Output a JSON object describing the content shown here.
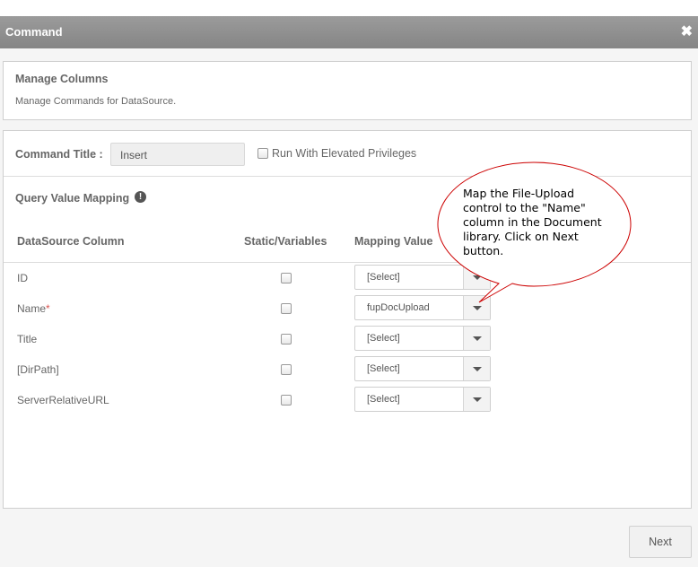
{
  "dialog": {
    "title": "Command",
    "close_glyph": "✖"
  },
  "manage": {
    "heading": "Manage Columns",
    "description": "Manage Commands for DataSource."
  },
  "command_title": {
    "label": "Command Title :",
    "value": "Insert"
  },
  "elevated": {
    "label": "Run With Elevated Privileges",
    "checked": false
  },
  "query_mapping": {
    "heading": "Query Value Mapping",
    "info_icon": "!"
  },
  "table": {
    "headers": [
      "DataSource Column",
      "Static/Variables",
      "Mapping Value"
    ],
    "rows": [
      {
        "column": "ID",
        "required": "",
        "mapping": "[Select]"
      },
      {
        "column": "Name",
        "required": "*",
        "mapping": "fupDocUpload"
      },
      {
        "column": "Title",
        "required": "",
        "mapping": "[Select]"
      },
      {
        "column": "[DirPath]",
        "required": "",
        "mapping": "[Select]"
      },
      {
        "column": "ServerRelativeURL",
        "required": "",
        "mapping": "[Select]"
      }
    ]
  },
  "callout": {
    "text": "Map the File-Upload control to the \"Name\" column in the Document library. Click on Next button."
  },
  "footer": {
    "next_label": "Next"
  },
  "colors": {
    "titlebar": "#8f8f8f",
    "callout_border": "#cc0000",
    "required": "#d9534f"
  }
}
